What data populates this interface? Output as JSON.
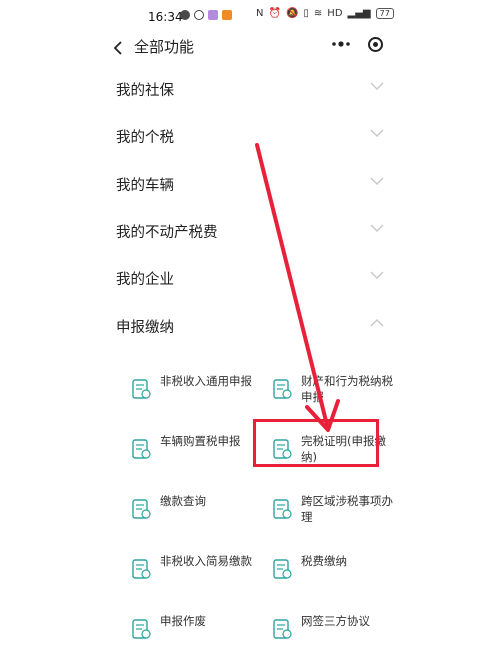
{
  "status_bar": {
    "time": "16:34",
    "battery": "77",
    "signal_text": "HD"
  },
  "header": {
    "title": "全部功能",
    "more_icon": "more-horizontal-icon",
    "target_icon": "record-target-icon"
  },
  "menu": [
    {
      "label": "我的社保",
      "expanded": false
    },
    {
      "label": "我的个税",
      "expanded": false
    },
    {
      "label": "我的车辆",
      "expanded": false
    },
    {
      "label": "我的不动产税费",
      "expanded": false
    },
    {
      "label": "我的企业",
      "expanded": false
    },
    {
      "label": "申报缴纳",
      "expanded": true
    }
  ],
  "grid": [
    {
      "label": "非税收入通用申报",
      "icon": "document-refresh-icon"
    },
    {
      "label": "财产和行为税纳税申报",
      "icon": "property-tax-icon"
    },
    {
      "label": "车辆购置税申报",
      "icon": "vehicle-tax-icon"
    },
    {
      "label": "完税证明(申报缴纳)",
      "icon": "certificate-icon"
    },
    {
      "label": "缴款查询",
      "icon": "payment-query-icon"
    },
    {
      "label": "跨区域涉税事项办理",
      "icon": "location-doc-icon"
    },
    {
      "label": "非税收入简易缴款",
      "icon": "list-doc-icon"
    },
    {
      "label": "税费缴纳",
      "icon": "tax-payment-icon"
    },
    {
      "label": "申报作废",
      "icon": "void-doc-icon"
    },
    {
      "label": "网签三方协议",
      "icon": "agreement-icon"
    }
  ],
  "colors": {
    "accent": "#2aa6a0",
    "annotation": "#e8203a"
  }
}
